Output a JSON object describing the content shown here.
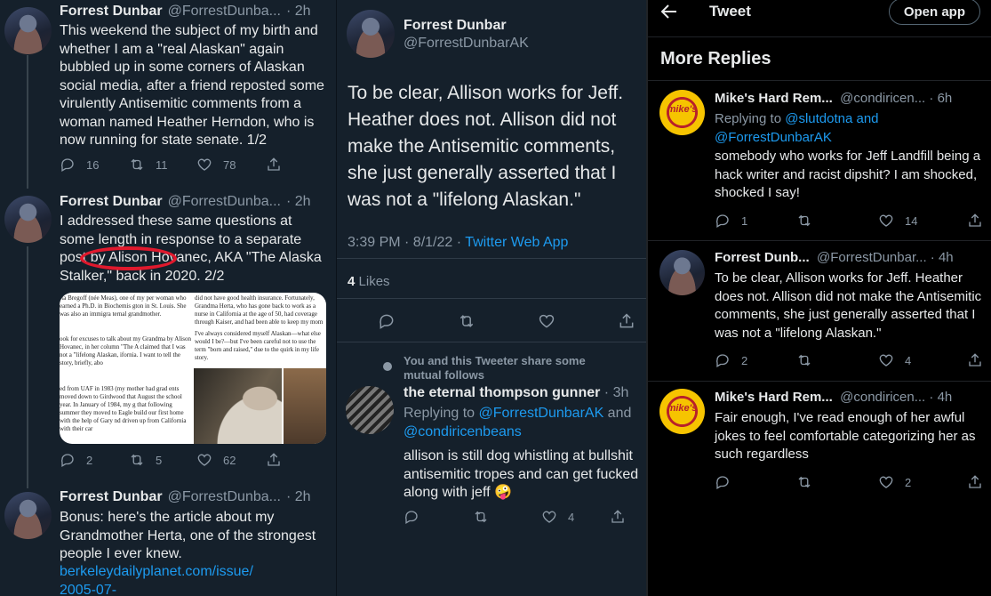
{
  "panel1": {
    "tweets": [
      {
        "name": "Forrest Dunbar",
        "handle": "@ForrestDunba...",
        "time": "· 2h",
        "text": "This weekend the subject of my birth and whether I am a \"real Alaskan\" again bubbled up in some corners of Alaskan social media, after a friend reposted some virulently Antisemitic comments from a woman named Heather Herndon, who is now running for state senate. 1/2",
        "replies": "16",
        "retweets": "11",
        "likes": "78"
      },
      {
        "name": "Forrest Dunbar",
        "handle": "@ForrestDunba...",
        "time": "· 2h",
        "text": "I addressed these same questions at some length in response to a separate post by Alison Hovanec, AKA \"The Alaska Stalker,\" back in 2020. 2/2",
        "replies": "2",
        "retweets": "5",
        "likes": "62",
        "attachment": {
          "col1": "rta Bregoff (née Meas), one of my per woman who earned a Ph.D. in Biochemis gton in St. Louis. She was also an immigra ternal grandmother.",
          "col2": "ook for excuses to talk about my Grandma by Alison Hovanec, in her column \"The A claimed that I was not a \"lifelong Alaskan, ifornia. I want to tell the story, briefly, abo",
          "col3": "did not have good health insurance. Fortunately, Grandma Herta, who has gone back to work as a nurse in California at the age of 50, had coverage through Kaiser, and had been able to keep my mom on her plan.",
          "col4": "I've always considered myself Alaskan—what else would I be?—but I've been careful not to use the term \"born and raised,\" due to the quirk in my life story.",
          "col5": "ed from UAF in 1983 (my mother had grad ents moved down to Girdwood that August the school year. In January of 1984, my g that following summer they moved to Eagle build our first home with the help of Gary nd driven up from California with their car"
        }
      },
      {
        "name": "Forrest Dunbar",
        "handle": "@ForrestDunba...",
        "time": "· 2h",
        "text": "Bonus: here's the article about my Grandmother Herta, one of the strongest people I ever knew.",
        "link": "berkeleydailyplanet.com/issue/ 2005-07-"
      }
    ]
  },
  "panel2": {
    "author": {
      "name": "Forrest Dunbar",
      "handle": "@ForrestDunbarAK"
    },
    "text": "To be clear, Allison works for Jeff. Heather does not. Allison did not make the Antisemitic comments, she just generally asserted that I was not a \"lifelong Alaskan.\"",
    "timestamp": "3:39 PM · 8/1/22 · ",
    "source": "Twitter Web App",
    "likes_count": "4",
    "likes_label": "Likes",
    "social_context": "You and this Tweeter share some mutual follows",
    "reply": {
      "name": "the eternal thompson gunner",
      "time": "· 3h",
      "replying_prefix": "Replying to ",
      "replying_users": "@ForrestDunbarAK",
      "replying_and": " and ",
      "replying_users2": "@condiricenbeans",
      "text": "allison is still dog whistling at bullshit antisemitic tropes and can get fucked along with jeff 🤪",
      "likes": "4"
    }
  },
  "panel3": {
    "header_title": "Tweet",
    "open_app": "Open app",
    "section_title": "More Replies",
    "replies": [
      {
        "name": "Mike's Hard Rem...",
        "handle": "@condiricen...",
        "time": "· 6h",
        "replying_prefix": "Replying to ",
        "replying_a": "@slutdotna",
        "replying_and": " and",
        "replying_b": "@ForrestDunbarAK",
        "text": "somebody who works for Jeff Landfill being a hack writer and racist dipshit? I am shocked, shocked I say!",
        "replies": "1",
        "retweets": "",
        "likes": "14",
        "avatar_text": "mike's"
      },
      {
        "name": "Forrest Dunb...",
        "handle": "@ForrestDunbar...",
        "time": "· 4h",
        "text": "To be clear, Allison works for Jeff. Heather does not. Allison did not make the Antisemitic comments, she just generally asserted that I was not a \"lifelong Alaskan.\"",
        "replies": "2",
        "retweets": "",
        "likes": "4"
      },
      {
        "name": "Mike's Hard Rem...",
        "handle": "@condiricen...",
        "time": "· 4h",
        "text": "Fair enough, I've read enough of her awful jokes to feel comfortable categorizing her as such regardless",
        "replies": "",
        "retweets": "",
        "likes": "2",
        "avatar_text": "mike's"
      }
    ]
  },
  "colors": {
    "dim_bg": "#15202b",
    "black_bg": "#000000",
    "accent": "#1d9bf0",
    "highlight": "#e0192d"
  }
}
